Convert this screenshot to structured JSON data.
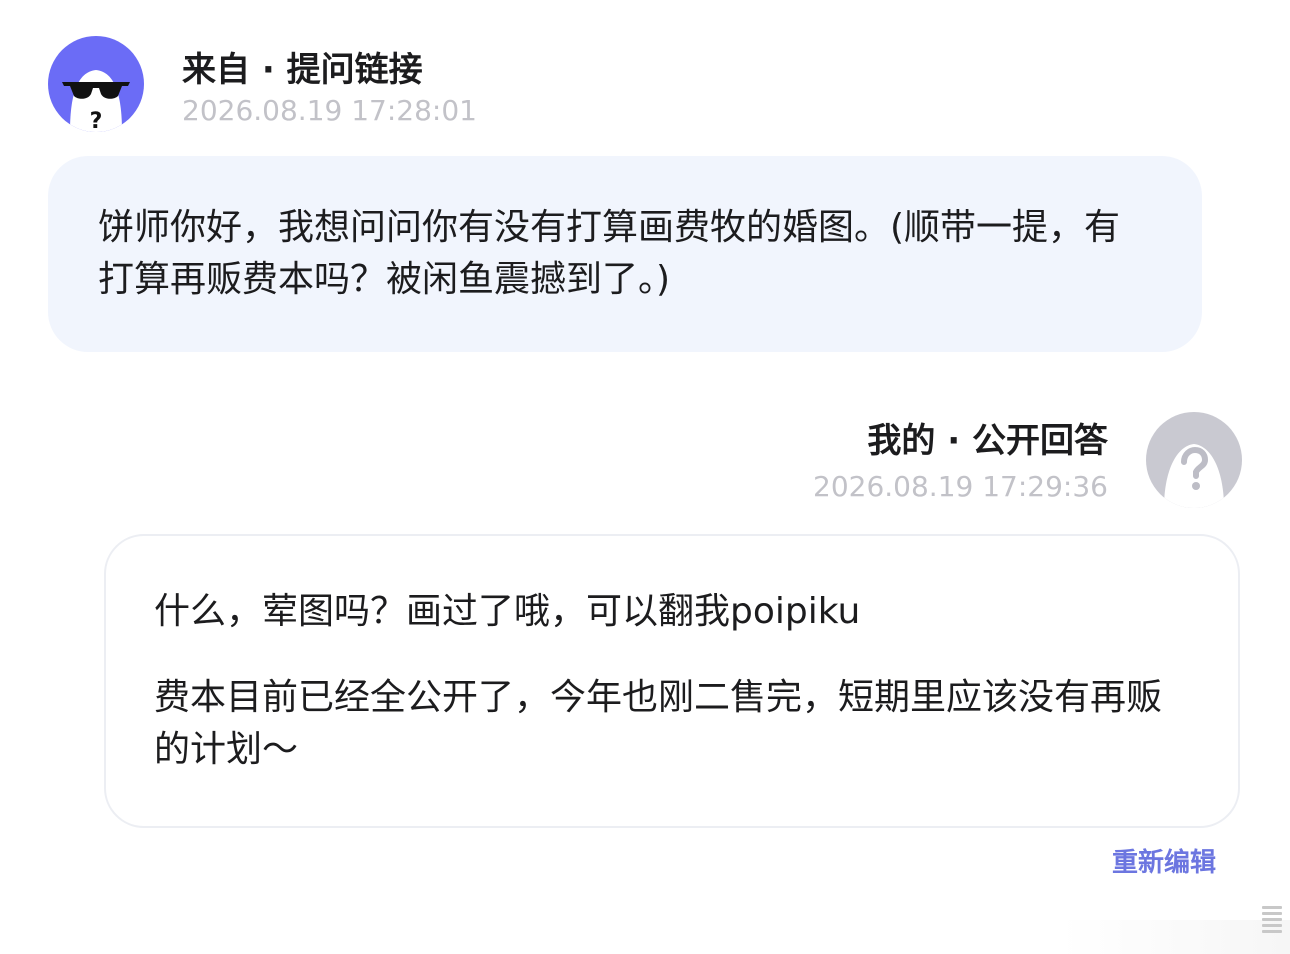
{
  "question": {
    "source_label": "来自 · 提问链接",
    "timestamp": "2026.08.19 17:28:01",
    "avatar": "anonymous-sunglasses-icon",
    "text": "饼师你好，我想问问你有没有打算画费牧的婚图。(顺带一提，有打算再贩费本吗？被闲鱼震撼到了。)"
  },
  "answer": {
    "label": "我的 · 公开回答",
    "timestamp": "2026.08.19 17:29:36",
    "avatar": "anonymous-question-mark-icon",
    "paragraphs": [
      "什么，荤图吗？画过了哦，可以翻我poipiku",
      "费本目前已经全公开了，今年也刚二售完，短期里应该没有再贩的计划～"
    ]
  },
  "actions": {
    "re_edit": "重新编辑"
  },
  "colors": {
    "question_avatar_bg": "#6b6cf6",
    "question_bubble_bg": "#f1f5fd",
    "answer_avatar_bg": "#c9c9d1",
    "timestamp": "#c2c2c8",
    "link": "#6c76e0"
  }
}
